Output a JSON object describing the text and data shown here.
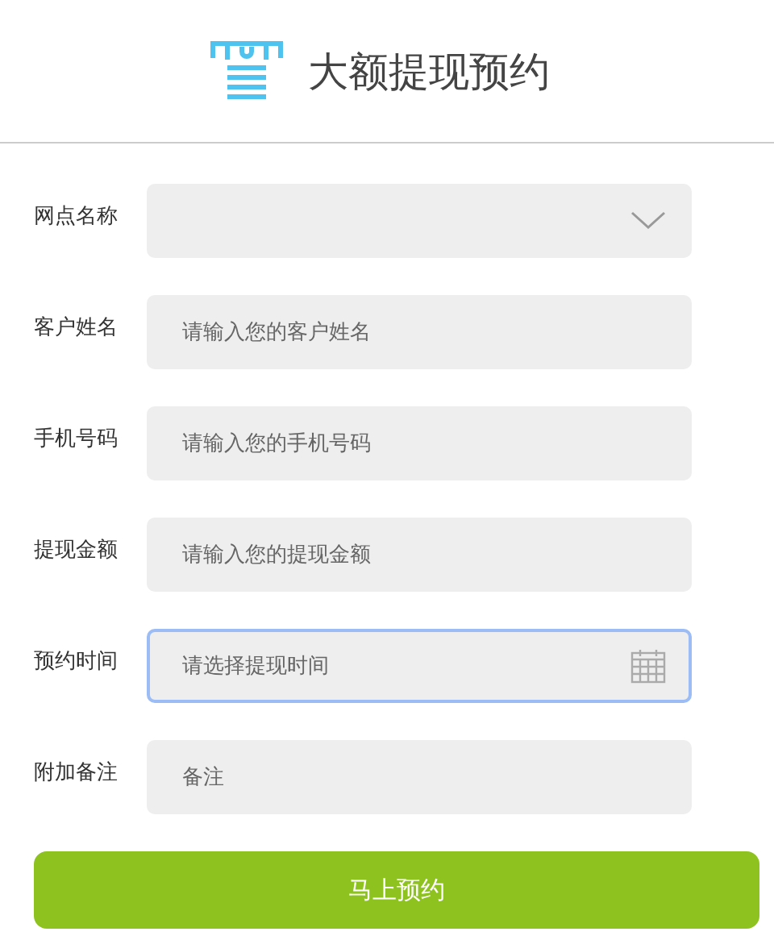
{
  "header": {
    "title": "大额提现预约"
  },
  "fields": [
    {
      "kind": "select",
      "label": "网点名称",
      "focused": false
    },
    {
      "kind": "text",
      "label": "客户姓名",
      "placeholder": "请输入您的客户姓名",
      "focused": false
    },
    {
      "kind": "text",
      "label": "手机号码",
      "placeholder": "请输入您的手机号码",
      "focused": false
    },
    {
      "kind": "text",
      "label": "提现金额",
      "placeholder": "请输入您的提现金额",
      "focused": false
    },
    {
      "kind": "date",
      "label": "预约时间",
      "placeholder": "请选择提现时间",
      "focused": true
    },
    {
      "kind": "text",
      "label": "附加备注",
      "placeholder": "备注",
      "focused": false
    }
  ],
  "submit": {
    "label": "马上预约"
  }
}
